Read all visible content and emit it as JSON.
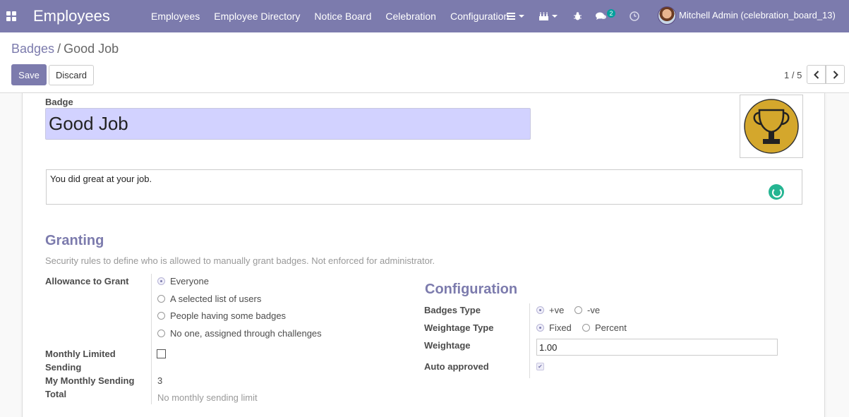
{
  "navbar": {
    "brand": "Employees",
    "menu": [
      "Employees",
      "Employee Directory",
      "Notice Board",
      "Celebration",
      "Configuration"
    ],
    "messages_count": "2",
    "user": "Mitchell Admin (celebration_board_13)"
  },
  "breadcrumb": {
    "parent": "Badges",
    "separator": "/",
    "current": "Good Job"
  },
  "buttons": {
    "save": "Save",
    "discard": "Discard"
  },
  "pager": {
    "value": "1 / 5"
  },
  "form": {
    "badge_label": "Badge",
    "name": "Good Job",
    "description": "You did great at your job.",
    "granting": {
      "title": "Granting",
      "hint": "Security rules to define who is allowed to manually grant badges. Not enforced for administrator.",
      "allowance_label": "Allowance to Grant",
      "options": [
        "Everyone",
        "A selected list of users",
        "People having some badges",
        "No one, assigned through challenges"
      ],
      "selected": "Everyone",
      "monthly_limited_label_1": "Monthly Limited",
      "monthly_limited_label_2": "Sending",
      "monthly_limited": false,
      "my_monthly_label_1": "My Monthly Sending",
      "my_monthly_label_2": "Total",
      "my_monthly_value": "3",
      "no_limit_text": "No monthly sending limit"
    },
    "configuration": {
      "title": "Configuration",
      "badges_type_label": "Badges Type",
      "badges_type_options": [
        "+ve",
        "-ve"
      ],
      "badges_type_selected": "+ve",
      "weightage_type_label": "Weightage Type",
      "weightage_type_options": [
        "Fixed",
        "Percent"
      ],
      "weightage_type_selected": "Fixed",
      "weightage_label": "Weightage",
      "weightage_value": "1.00",
      "auto_approved_label": "Auto approved",
      "auto_approved": true
    }
  },
  "colors": {
    "brand": "#7c7bad",
    "name_field_bg": "#d2d2ff",
    "trophy": "#d4a72c",
    "spinner": "#25b592"
  },
  "icons": {
    "apps": "apps-grid-icon",
    "list": "bars-icon",
    "activity": "cake-icon",
    "debug": "bug-icon",
    "chat": "chat-bubbles-icon",
    "clock": "clock-icon",
    "badge_image": "trophy-icon"
  }
}
